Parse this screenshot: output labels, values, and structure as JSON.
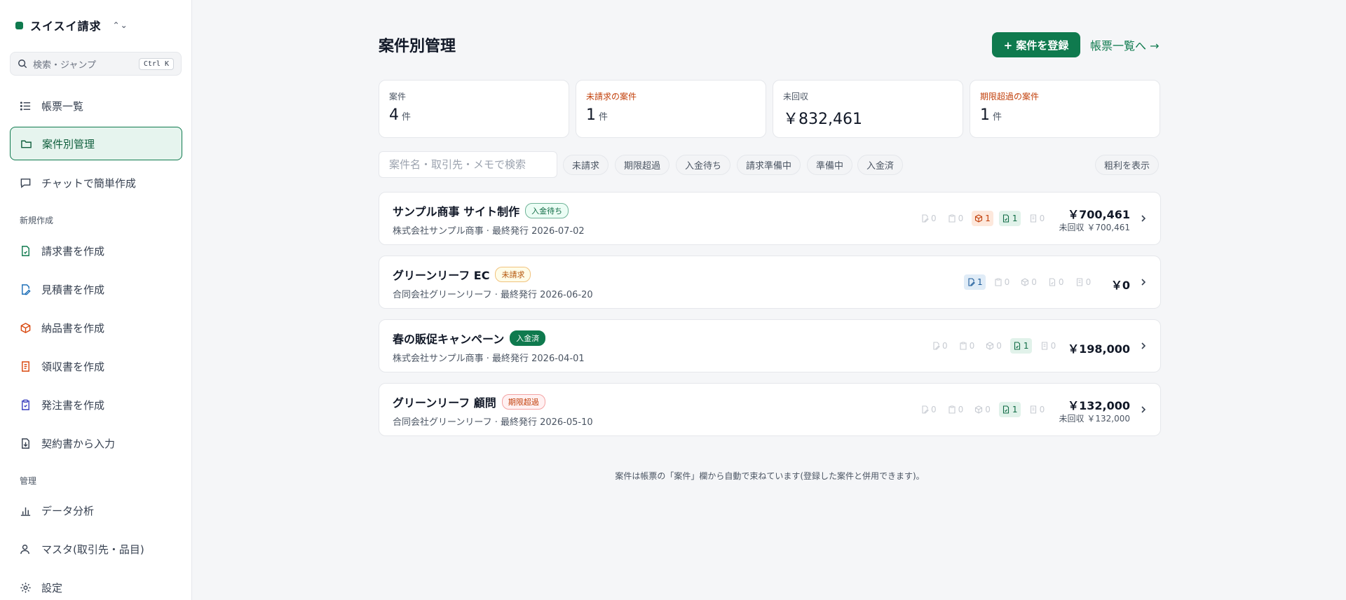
{
  "sidebar": {
    "brand": "スイスイ請求",
    "search": {
      "placeholder": "検索・ジャンプ",
      "shortcut": "Ctrl K"
    },
    "nav": [
      {
        "label": "帳票一覧",
        "icon": "list-icon"
      },
      {
        "label": "案件別管理",
        "icon": "folder-icon",
        "active": true
      },
      {
        "label": "チャットで簡単作成",
        "icon": "chat-icon"
      }
    ],
    "section_create": "新規作成",
    "create_items": [
      {
        "label": "請求書を作成",
        "icon": "invoice-icon",
        "color": "#0f7a4e"
      },
      {
        "label": "見積書を作成",
        "icon": "estimate-icon",
        "color": "#1d6fb8"
      },
      {
        "label": "納品書を作成",
        "icon": "box-icon",
        "color": "#d9480f"
      },
      {
        "label": "領収書を作成",
        "icon": "receipt-icon",
        "color": "#d9480f"
      },
      {
        "label": "発注書を作成",
        "icon": "clipboard-icon",
        "color": "#3b3fbf"
      },
      {
        "label": "契約書から入力",
        "icon": "import-doc-icon",
        "color": "#374151"
      }
    ],
    "section_manage": "管理",
    "manage_items": [
      {
        "label": "データ分析",
        "icon": "bar-chart-icon"
      },
      {
        "label": "マスタ(取引先・品目)",
        "icon": "user-icon"
      },
      {
        "label": "設定",
        "icon": "gear-icon"
      }
    ]
  },
  "header": {
    "title": "案件別管理",
    "add_button": "+ 案件を登録",
    "doc_link": "帳票一覧へ →"
  },
  "stats": [
    {
      "label": "案件",
      "value": "4",
      "unit": "件",
      "warn": false
    },
    {
      "label": "未請求の案件",
      "value": "1",
      "unit": "件",
      "warn": true
    },
    {
      "label": "未回収",
      "value": "￥832,461",
      "unit": "",
      "warn": false
    },
    {
      "label": "期限超過の案件",
      "value": "1",
      "unit": "件",
      "warn": true
    }
  ],
  "filters": {
    "search_placeholder": "案件名・取引先・メモで検索",
    "chips": [
      "未請求",
      "期限超過",
      "入金待ち",
      "請求準備中",
      "準備中",
      "入金済"
    ],
    "margin_toggle": "粗利を表示"
  },
  "cases": [
    {
      "title": "サンプル商事 サイト制作",
      "status": "入金待ち",
      "status_kind": "wait",
      "meta": "株式会社サンプル商事 · 最終発行 2026-07-02",
      "docs": [
        {
          "icon": "estimate-icon",
          "count": "0",
          "hl": ""
        },
        {
          "icon": "clipboard-icon",
          "count": "0",
          "hl": ""
        },
        {
          "icon": "box-icon",
          "count": "1",
          "hl": "hl-orange"
        },
        {
          "icon": "invoice-icon",
          "count": "1",
          "hl": "hl-green"
        },
        {
          "icon": "receipt-icon",
          "count": "0",
          "hl": ""
        }
      ],
      "amount": "￥700,461",
      "remaining": "未回収 ￥700,461"
    },
    {
      "title": "グリーンリーフ EC",
      "status": "未請求",
      "status_kind": "unbilled",
      "meta": "合同会社グリーンリーフ · 最終発行 2026-06-20",
      "docs": [
        {
          "icon": "estimate-icon",
          "count": "1",
          "hl": "hl-blue"
        },
        {
          "icon": "clipboard-icon",
          "count": "0",
          "hl": ""
        },
        {
          "icon": "box-icon",
          "count": "0",
          "hl": ""
        },
        {
          "icon": "invoice-icon",
          "count": "0",
          "hl": ""
        },
        {
          "icon": "receipt-icon",
          "count": "0",
          "hl": ""
        }
      ],
      "amount": "￥0",
      "remaining": ""
    },
    {
      "title": "春の販促キャンペーン",
      "status": "入金済",
      "status_kind": "paid",
      "meta": "株式会社サンプル商事 · 最終発行 2026-04-01",
      "docs": [
        {
          "icon": "estimate-icon",
          "count": "0",
          "hl": ""
        },
        {
          "icon": "clipboard-icon",
          "count": "0",
          "hl": ""
        },
        {
          "icon": "box-icon",
          "count": "0",
          "hl": ""
        },
        {
          "icon": "invoice-icon",
          "count": "1",
          "hl": "hl-green"
        },
        {
          "icon": "receipt-icon",
          "count": "0",
          "hl": ""
        }
      ],
      "amount": "￥198,000",
      "remaining": ""
    },
    {
      "title": "グリーンリーフ 顧問",
      "status": "期限超過",
      "status_kind": "overdue",
      "meta": "合同会社グリーンリーフ · 最終発行 2026-05-10",
      "docs": [
        {
          "icon": "estimate-icon",
          "count": "0",
          "hl": ""
        },
        {
          "icon": "clipboard-icon",
          "count": "0",
          "hl": ""
        },
        {
          "icon": "box-icon",
          "count": "0",
          "hl": ""
        },
        {
          "icon": "invoice-icon",
          "count": "1",
          "hl": "hl-green"
        },
        {
          "icon": "receipt-icon",
          "count": "0",
          "hl": ""
        }
      ],
      "amount": "￥132,000",
      "remaining": "未回収 ￥132,000"
    }
  ],
  "footer_note": "案件は帳票の「案件」欄から自動で束ねています(登録した案件と併用できます)。"
}
